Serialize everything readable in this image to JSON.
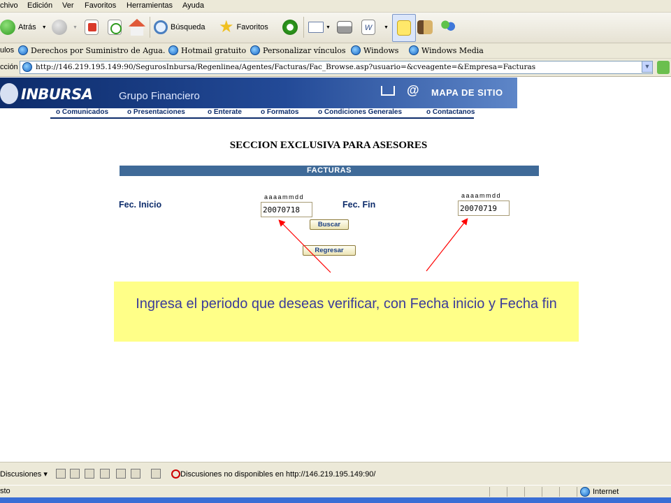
{
  "menu": [
    "chivo",
    "Edición",
    "Ver",
    "Favoritos",
    "Herramientas",
    "Ayuda"
  ],
  "toolbar": {
    "back_label": "Atrás",
    "search_label": "Búsqueda",
    "favorites_label": "Favoritos"
  },
  "links": {
    "prefix": "ulos",
    "items": [
      "Derechos por Suministro de Agua.",
      "Hotmail gratuito",
      "Personalizar vínculos",
      "Windows",
      "Windows Media"
    ]
  },
  "address": {
    "prefix": "cción",
    "url": "http://146.219.195.149:90/SegurosInbursa/Regenlinea/Agentes/Facturas/Fac_Browse.asp?usuario=&cveagente=&Empresa=Facturas"
  },
  "site": {
    "brand": "INBURSA",
    "brand_sub": "Grupo Financiero",
    "map_link": "MAPA DE SITIO",
    "nav": [
      "Comunicados",
      "Presentaciones",
      "Enterate",
      "Formatos",
      "Condiciones Generales",
      "Contactanos"
    ]
  },
  "page": {
    "section_title": "SECCION EXCLUSIVA PARA ASESORES",
    "panel_title": "FACTURAS",
    "start_label": "Fec. Inicio",
    "end_label": "Fec. Fin",
    "date_format": "aaaammdd",
    "start_value": "20070718",
    "end_value": "20070719",
    "search_button": "Buscar",
    "back_button": "Regresar"
  },
  "note": {
    "text": "Ingresa el periodo que deseas verificar, con Fecha inicio y Fecha fin"
  },
  "discussions": {
    "label": "Discusiones",
    "status": "Discusiones no disponibles en http://146.219.195.149:90/"
  },
  "status": {
    "text": "sto",
    "zone": "Internet"
  },
  "colors": {
    "banner": "#0d2c6b",
    "panel_bar": "#3f6a98",
    "note_bg": "#ffff88",
    "arrow": "#ff0000"
  }
}
